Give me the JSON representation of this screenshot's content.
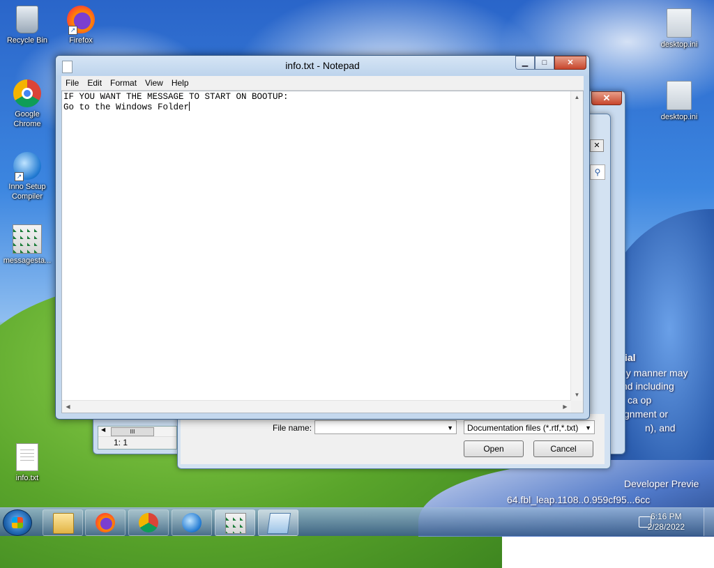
{
  "desktop": {
    "icons_left": [
      {
        "label": "Recycle Bin",
        "icon": "recycle-bin-icon"
      },
      {
        "label": "Firefox",
        "icon": "firefox-icon"
      },
      {
        "label": "Google Chrome",
        "icon": "chrome-icon"
      },
      {
        "label": "Inno Setup Compiler",
        "icon": "inno-setup-icon"
      },
      {
        "label": "messagesta...",
        "icon": "script-file-icon"
      },
      {
        "label": "info.txt",
        "icon": "text-file-icon"
      }
    ],
    "icons_right": [
      {
        "label": "desktop.ini",
        "icon": "ini-file-icon"
      },
      {
        "label": "desktop.ini",
        "icon": "ini-file-icon"
      }
    ],
    "background_text": {
      "line1": "ial",
      "line2": "ny manner may",
      "line3": "nd including",
      "line4": "ca op",
      "line5": "gnment or",
      "line6": "n), and",
      "line7": "Developer Previe",
      "line8": "64.fbl_leap.1108..0.959cf95...6cc"
    }
  },
  "background_window": {
    "status": "1:  1",
    "hscroll_thumb": "III"
  },
  "open_dialog": {
    "file_name_label": "File name:",
    "file_name_value": "",
    "file_type": "Documentation files (*.rtf,*.txt)",
    "open_button": "Open",
    "cancel_button": "Cancel"
  },
  "notepad": {
    "title": "info.txt - Notepad",
    "menu": [
      "File",
      "Edit",
      "Format",
      "View",
      "Help"
    ],
    "content_line1": "IF YOU WANT THE MESSAGE TO START ON BOOTUP:",
    "content_line2": "Go to the Windows Folder",
    "caption": {
      "minimize": "▁",
      "maximize": "□",
      "close": "✕"
    }
  },
  "taskbar": {
    "clock_time": "6:16 PM",
    "clock_date": "2/28/2022",
    "buttons": [
      "file-explorer-icon",
      "firefox-icon",
      "chrome-icon",
      "inno-setup-icon",
      "script-file-icon",
      "notepad-icon"
    ]
  }
}
